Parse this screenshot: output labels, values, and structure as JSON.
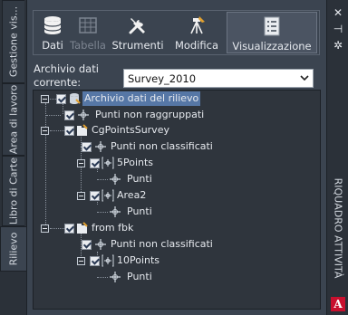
{
  "left_tabs": [
    "Gestione vis...",
    "Area di lavoro",
    "Libro di Carte",
    "Rilievo"
  ],
  "toolbar": {
    "dati": "Dati",
    "tabella": "Tabella",
    "strumenti": "Strumenti",
    "modifica": "Modifica",
    "visualizzazione": "Visualizzazione"
  },
  "archive": {
    "label_line1": "Archivio dati",
    "label_line2": "corrente:",
    "value": "Survey_2010"
  },
  "tree": {
    "root": "Archivio dati del rilievo",
    "n1": "Punti non raggruppati",
    "n2": "CgPointsSurvey",
    "n3": "Punti non classificati",
    "n4": "5Points",
    "n5": "Punti",
    "n6": "Area2",
    "n7": "Punti",
    "n8": "from fbk",
    "n9": "Punti non classificati",
    "n10": "10Points",
    "n11": "Punti"
  },
  "right_strip": {
    "title": "RIQUADRO ATTIVITÀ",
    "close": "✕",
    "pin": "⊣",
    "settings": "✲",
    "logo": "A"
  }
}
